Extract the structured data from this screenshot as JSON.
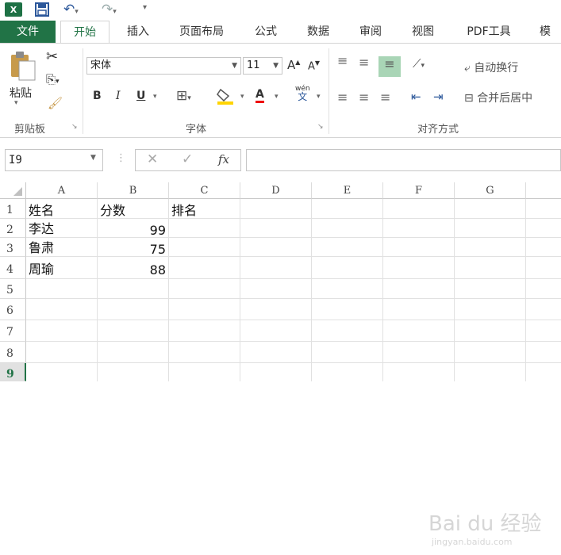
{
  "qat": {
    "app_badge": "X",
    "undo_dd": "▾",
    "redo_dd": "▾",
    "customize": "▾"
  },
  "tabs": [
    "文件",
    "开始",
    "插入",
    "页面布局",
    "公式",
    "数据",
    "审阅",
    "视图",
    "PDF工具",
    "模"
  ],
  "ribbon": {
    "clipboard": {
      "paste": "粘贴",
      "label": "剪贴板"
    },
    "font": {
      "name": "宋体",
      "size": "11",
      "grow": "A",
      "shrink": "A",
      "bold": "B",
      "italic": "I",
      "underline": "U",
      "color_a": "A",
      "phonetic": "wén",
      "phonetic_zh": "文",
      "label": "字体"
    },
    "align": {
      "wrap": "自动换行",
      "merge": "合并后居中",
      "label": "对齐方式"
    }
  },
  "formula_bar": {
    "name_box": "I9",
    "fx": "fx",
    "formula": ""
  },
  "columns": [
    "A",
    "B",
    "C",
    "D",
    "E",
    "F",
    "G"
  ],
  "rows": [
    "1",
    "2",
    "3",
    "4",
    "5",
    "6",
    "7",
    "8",
    "9"
  ],
  "selected_row": "9",
  "cells": [
    [
      "姓名",
      "分数",
      "排名"
    ],
    [
      "李达",
      "99",
      ""
    ],
    [
      "鲁肃",
      "75",
      ""
    ],
    [
      "周瑜",
      "88",
      ""
    ]
  ],
  "watermark": {
    "brand": "Bai du 经验",
    "url": "jingyan.baidu.com"
  },
  "colors": {
    "excel_green": "#217346",
    "accent_blue": "#2b579a"
  }
}
